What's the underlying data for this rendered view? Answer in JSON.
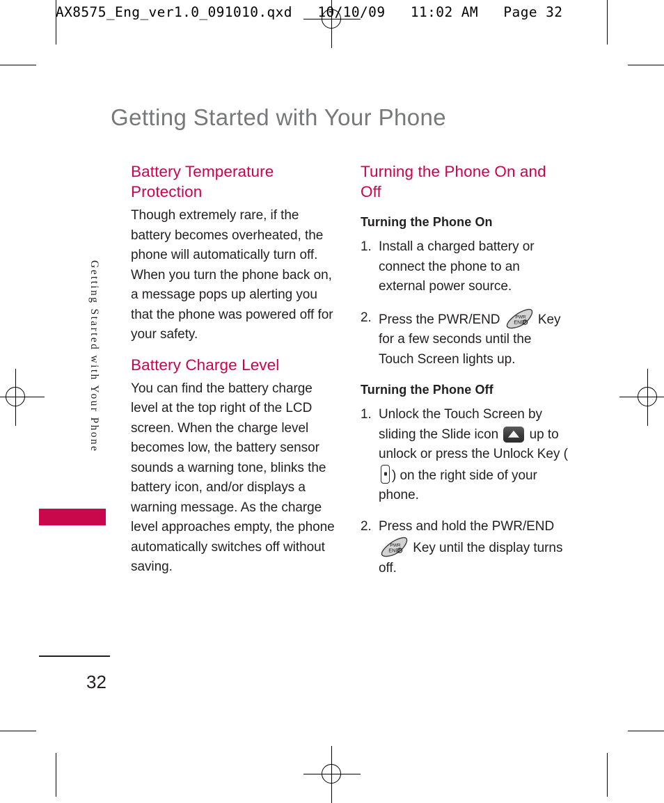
{
  "print_slug": "AX8575_Eng_ver1.0_091010.qxd   10/10/09   11:02 AM   Page 32",
  "page": {
    "title": "Getting Started with Your Phone",
    "folio": "32",
    "side_tab_label": "Getting Started with Your Phone",
    "accent_color": "#d1004f",
    "tab_color": "#c8084b",
    "title_color": "#77787a"
  },
  "left_column": {
    "sections": [
      {
        "heading": "Battery Temperature Protection",
        "paragraphs": [
          "Though extremely rare, if the battery becomes overheated, the phone will automatically turn off. When you turn the phone back on, a message pops up alerting you that the phone was powered off for your safety."
        ]
      },
      {
        "heading": "Battery Charge Level",
        "paragraphs": [
          "You can find the battery charge level at the top right of the LCD screen. When the charge level becomes low, the battery sensor sounds a warning tone, blinks the battery icon, and/or displays a warning message. As the charge level approaches empty, the phone automatically switches off without saving."
        ]
      }
    ]
  },
  "right_column": {
    "heading": "Turning the Phone On and Off",
    "subsections": [
      {
        "subheading": "Turning the Phone On",
        "steps": [
          {
            "number": "1.",
            "text_before": "Install a charged battery or connect the phone to an external power source.",
            "icon": null,
            "text_after": ""
          },
          {
            "number": "2.",
            "text_before": "Press the PWR/END",
            "icon": "pwr-end-key-icon",
            "text_after": "Key for a few seconds until the Touch Screen lights up."
          }
        ]
      },
      {
        "subheading": "Turning the Phone Off",
        "steps": [
          {
            "number": "1.",
            "text_before": "Unlock the Touch Screen by sliding the Slide icon",
            "icon": "slide-icon",
            "text_mid": "up to unlock or press the Unlock Key (",
            "icon2": "unlock-key-icon",
            "text_after": ") on the right side of your phone."
          },
          {
            "number": "2.",
            "text_before": "Press and hold the PWR/END",
            "icon": "pwr-end-key-icon",
            "text_after": "Key until the display turns off."
          }
        ]
      }
    ]
  },
  "key_icons": {
    "pwr_end": {
      "line1": "PWR",
      "line2": "END"
    },
    "slide": "slide-up-triangle",
    "unlock": "side-unlock-button"
  }
}
